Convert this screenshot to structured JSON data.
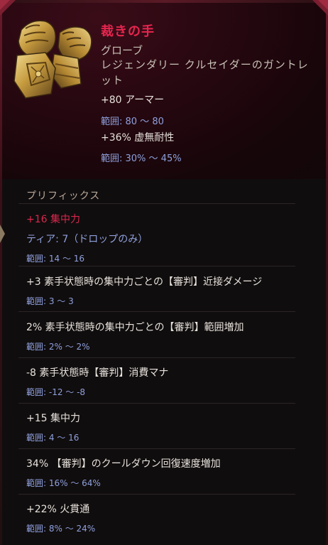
{
  "item": {
    "name": "裁きの手",
    "type": "グローブ",
    "rarity_line": "レジェンダリー クルセイダーのガントレット",
    "icon": "gauntlets-icon"
  },
  "base_stats": [
    {
      "text": "+80 アーマー",
      "range": "範囲: 80 〜 80"
    },
    {
      "text": "+36% 虚無耐性",
      "range": "範囲: 30% 〜 45%"
    }
  ],
  "prefix_header": "プリフィックス",
  "affixes": [
    {
      "text": "+16 集中力",
      "tier": "ティア: 7（ドロップのみ）",
      "range": "範囲: 14 〜 16"
    },
    {
      "text": "+3 素手状態時の集中力ごとの【審判】近接ダメージ",
      "range": "範囲: 3 〜 3"
    },
    {
      "text": "2% 素手状態時の集中力ごとの【審判】範囲増加",
      "range": "範囲: 2% 〜 2%"
    },
    {
      "text": "-8 素手状態時【審判】消費マナ",
      "range": "範囲: -12 〜 -8"
    },
    {
      "text": "+15 集中力",
      "range": "範囲: 4 〜 16"
    },
    {
      "text": "34% 【審判】のクールダウン回復速度増加",
      "range": "範囲: 16% 〜 64%"
    },
    {
      "text": "+22% 火貫通",
      "range": "範囲: 8% 〜 24%"
    }
  ],
  "colors": {
    "name": "#e6254e",
    "prefix_highlight": "#d8284c",
    "range": "#8fa0dc",
    "body_text": "#e7e2dc"
  }
}
